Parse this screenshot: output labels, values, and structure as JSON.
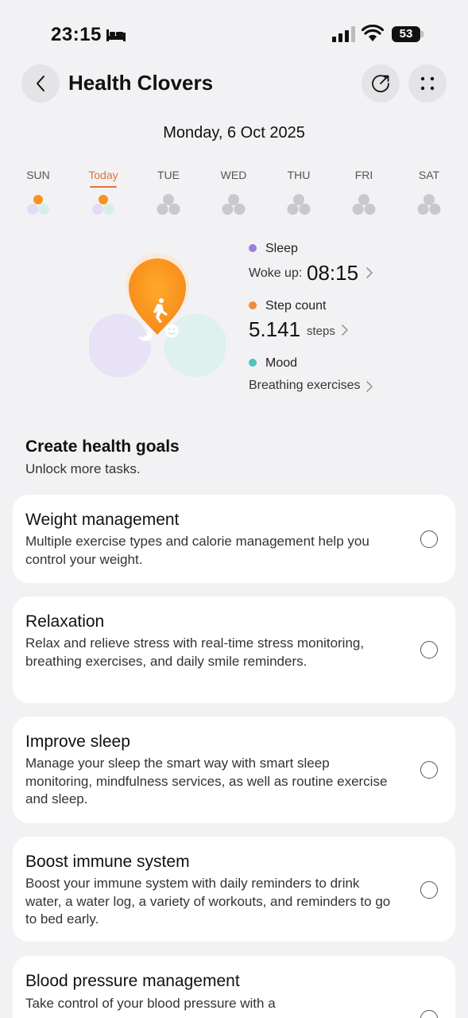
{
  "status_bar": {
    "time": "23:15",
    "battery": "53"
  },
  "header": {
    "title": "Health Clovers"
  },
  "date": "Monday, 6 Oct 2025",
  "week": [
    {
      "label": "SUN",
      "state": "partial"
    },
    {
      "label": "Today",
      "state": "active"
    },
    {
      "label": "TUE",
      "state": "empty"
    },
    {
      "label": "WED",
      "state": "empty"
    },
    {
      "label": "THU",
      "state": "empty"
    },
    {
      "label": "FRI",
      "state": "empty"
    },
    {
      "label": "SAT",
      "state": "empty"
    }
  ],
  "metrics": {
    "sleep": {
      "label": "Sleep",
      "sub_label": "Woke up:",
      "value": "08:15",
      "color": "#9b7de0"
    },
    "steps": {
      "label": "Step count",
      "value": "5.141",
      "unit": "steps",
      "color": "#f08a3e"
    },
    "mood": {
      "label": "Mood",
      "sub_label": "Breathing exercises",
      "color": "#4fc2c2"
    }
  },
  "goals": {
    "title": "Create health goals",
    "subtitle": "Unlock more tasks.",
    "items": [
      {
        "title": "Weight management",
        "description": "Multiple exercise types and calorie management help you control your weight."
      },
      {
        "title": "Relaxation",
        "description": "Relax and relieve stress with real-time stress monitoring, breathing exercises, and daily smile reminders."
      },
      {
        "title": "Improve sleep",
        "description": "Manage your sleep the smart way with smart sleep monitoring, mindfulness services, as well as routine exercise and sleep."
      },
      {
        "title": "Boost immune system",
        "description": "Boost your immune system with daily reminders to drink water, a water log, a variety of workouts, and reminders to go to bed early."
      },
      {
        "title": "Blood pressure management",
        "description": "Take control of your blood pressure with a"
      }
    ]
  },
  "colors": {
    "accent": "#e8703a",
    "orange": "#f7931e",
    "purple_soft": "#e9e3f7",
    "teal_soft": "#dff1ef",
    "gray_clover": "#c9c9cc"
  }
}
